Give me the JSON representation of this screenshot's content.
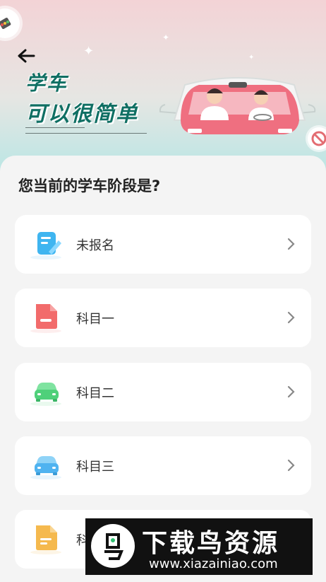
{
  "header": {
    "slogan_line1": "学车",
    "slogan_line2": "可以很简单",
    "back_icon": "arrow-left-icon"
  },
  "question": "您当前的学车阶段是?",
  "stages": [
    {
      "label": "未报名",
      "icon": "signup-form-icon",
      "color": "#3fb5f0"
    },
    {
      "label": "科目一",
      "icon": "document-icon",
      "color": "#f26b6b"
    },
    {
      "label": "科目二",
      "icon": "car-icon",
      "color": "#4fd07a"
    },
    {
      "label": "科目三",
      "icon": "car-icon",
      "color": "#4fb3f0"
    },
    {
      "label": "科目四",
      "icon": "document-icon",
      "color": "#f5b94e"
    }
  ],
  "watermark": {
    "title": "下载鸟资源",
    "url": "www.xiazainiao.com"
  }
}
